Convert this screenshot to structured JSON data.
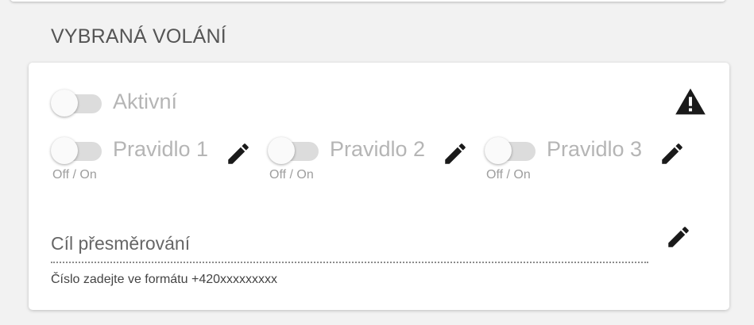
{
  "section": {
    "title": "VYBRANÁ VOLÁNÍ"
  },
  "active_toggle": {
    "label": "Aktivní",
    "checked": false
  },
  "rules": [
    {
      "label": "Pravidlo 1",
      "sublabel": "Off / On",
      "checked": false
    },
    {
      "label": "Pravidlo 2",
      "sublabel": "Off / On",
      "checked": false
    },
    {
      "label": "Pravidlo 3",
      "sublabel": "Off / On",
      "checked": false
    }
  ],
  "redirect": {
    "label": "Cíl přesměrování",
    "hint": "Číslo zadejte ve formátu +420xxxxxxxxx"
  },
  "icons": {
    "warning": "warning-icon",
    "edit": "pencil-icon"
  },
  "colors": {
    "background": "#f2f2f2",
    "card": "#ffffff",
    "disabled_text": "#b5b5b5",
    "icon": "#1a1a1a"
  }
}
